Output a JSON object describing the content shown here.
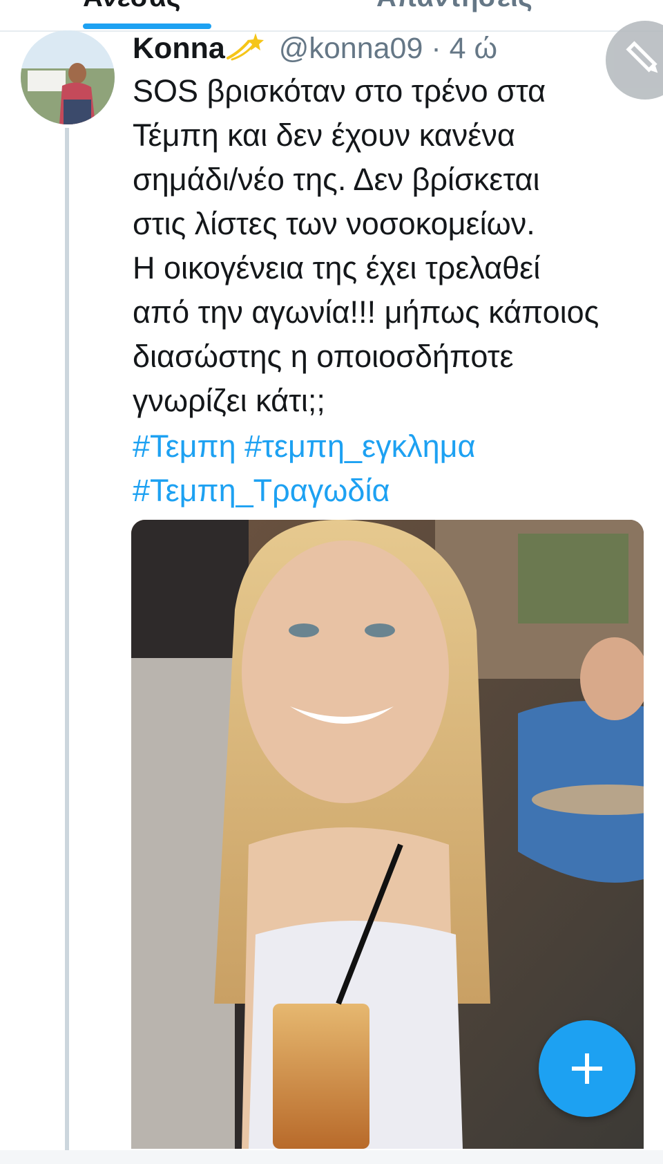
{
  "tabs": [
    {
      "label": "Ανεσας",
      "active": true
    },
    {
      "label": "Απαντήσεις",
      "active": false
    }
  ],
  "colors": {
    "accent": "#1da1f2",
    "text": "#14171a",
    "muted": "#657786"
  },
  "tweet": {
    "display_name": "Konna",
    "name_emoji": "dizzy-emoji",
    "handle": "@konna09",
    "separator": "·",
    "time": "4 ώ",
    "text_lines": [
      "SOS βρισκόταν στο τρένο στα",
      "Τέμπη και δεν έχουν κανένα",
      "σημάδι/νέο της. Δεν βρίσκεται",
      "στις λίστες των νοσοκομείων.",
      "Η οικογένεια της έχει τρελαθεί",
      "από την αγωνία!!! μήπως κάποιος",
      "διασώστης η οποιοσδήποτε",
      "γνωρίζει κάτι;;"
    ],
    "hashtag_lines": [
      "#Τεμπη #τεμπη_εγκλημα",
      "#Τεμπη_Τραγωδία"
    ]
  },
  "icons": {
    "edit": "pencil-icon",
    "compose": "plus-icon"
  }
}
